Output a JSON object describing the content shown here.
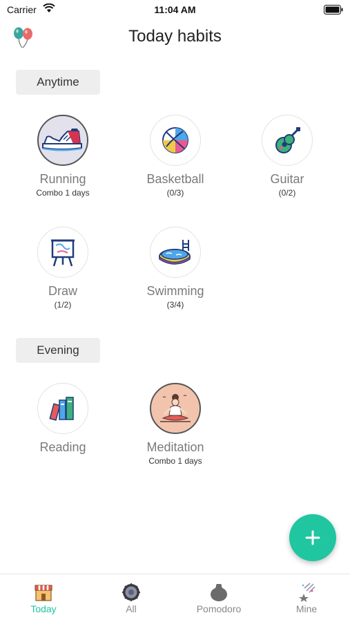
{
  "status_bar": {
    "carrier": "Carrier",
    "time": "11:04 AM"
  },
  "header": {
    "title": "Today habits"
  },
  "sections": [
    {
      "label": "Anytime"
    },
    {
      "label": "Evening"
    }
  ],
  "habits": [
    {
      "name": "Running",
      "sub": "Combo 1 days",
      "icon": "sneaker-icon"
    },
    {
      "name": "Basketball",
      "sub": "(0/3)",
      "icon": "basketball-icon"
    },
    {
      "name": "Guitar",
      "sub": "(0/2)",
      "icon": "guitar-icon"
    },
    {
      "name": "Draw",
      "sub": "(1/2)",
      "icon": "easel-icon"
    },
    {
      "name": "Swimming",
      "sub": "(3/4)",
      "icon": "pool-icon"
    },
    {
      "name": "Reading",
      "sub": "",
      "icon": "books-icon"
    },
    {
      "name": "Meditation",
      "sub": "Combo 1 days",
      "icon": "meditation-icon"
    }
  ],
  "tabs": [
    {
      "label": "Today",
      "icon": "shop-icon",
      "active": true
    },
    {
      "label": "All",
      "icon": "gear-ring-icon",
      "active": false
    },
    {
      "label": "Pomodoro",
      "icon": "tomato-pot-icon",
      "active": false
    },
    {
      "label": "Mine",
      "icon": "sparkle-star-icon",
      "active": false
    }
  ],
  "colors": {
    "accent": "#1fc6a0",
    "label_bg": "#eeeeee",
    "muted_text": "#7a7a7a"
  }
}
